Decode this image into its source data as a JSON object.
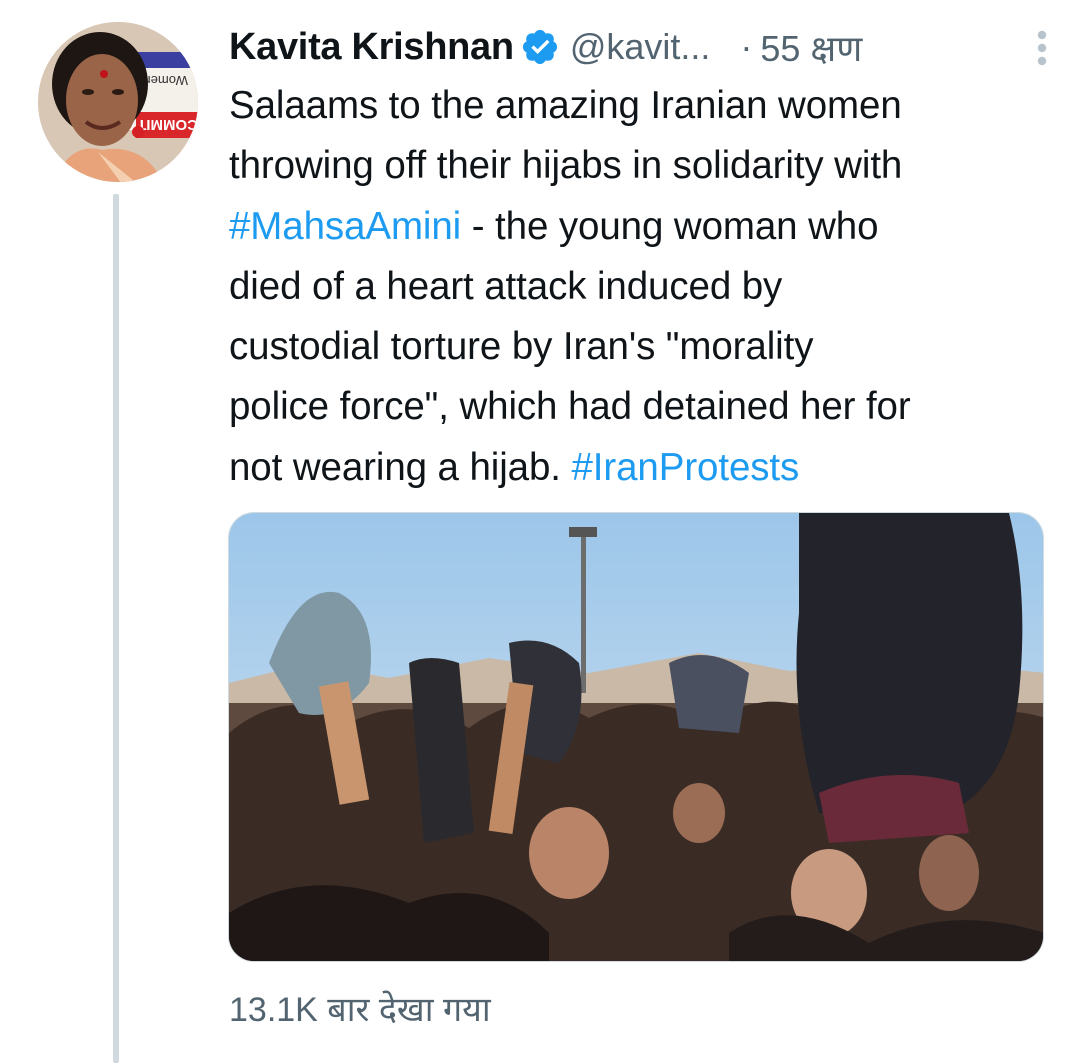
{
  "tweet": {
    "author": {
      "display_name": "Kavita Krishnan",
      "handle": "@kavit...",
      "verified": true,
      "avatar_banner_text": "Women's",
      "avatar_banner_text_2": "COMMITT"
    },
    "separator": "·",
    "timestamp": "55 क्षण",
    "text_lines": [
      [
        {
          "text": "Salaams to the amazing Iranian women",
          "type": "text"
        }
      ],
      [
        {
          "text": "throwing off their hijabs in solidarity with",
          "type": "text"
        }
      ],
      [
        {
          "text": "#MahsaAmini",
          "type": "hashtag"
        },
        {
          "text": " - the young woman who",
          "type": "text"
        }
      ],
      [
        {
          "text": "died of a heart attack induced by",
          "type": "text"
        }
      ],
      [
        {
          "text": "custodial torture by Iran's \"morality",
          "type": "text"
        }
      ],
      [
        {
          "text": "police force\", which had detained her for",
          "type": "text"
        }
      ],
      [
        {
          "text": "not wearing a hijab. ",
          "type": "text"
        },
        {
          "text": "#IranProtests",
          "type": "hashtag"
        }
      ]
    ],
    "views_label": "13.1K बार देखा गया"
  },
  "colors": {
    "text": "#0f1419",
    "secondary": "#536471",
    "link": "#1d9bf0",
    "verified": "#1d9bf0",
    "thread_line": "#cfd9de"
  },
  "icons": {
    "verified": "verified-badge-icon",
    "more": "more-vertical-icon"
  }
}
